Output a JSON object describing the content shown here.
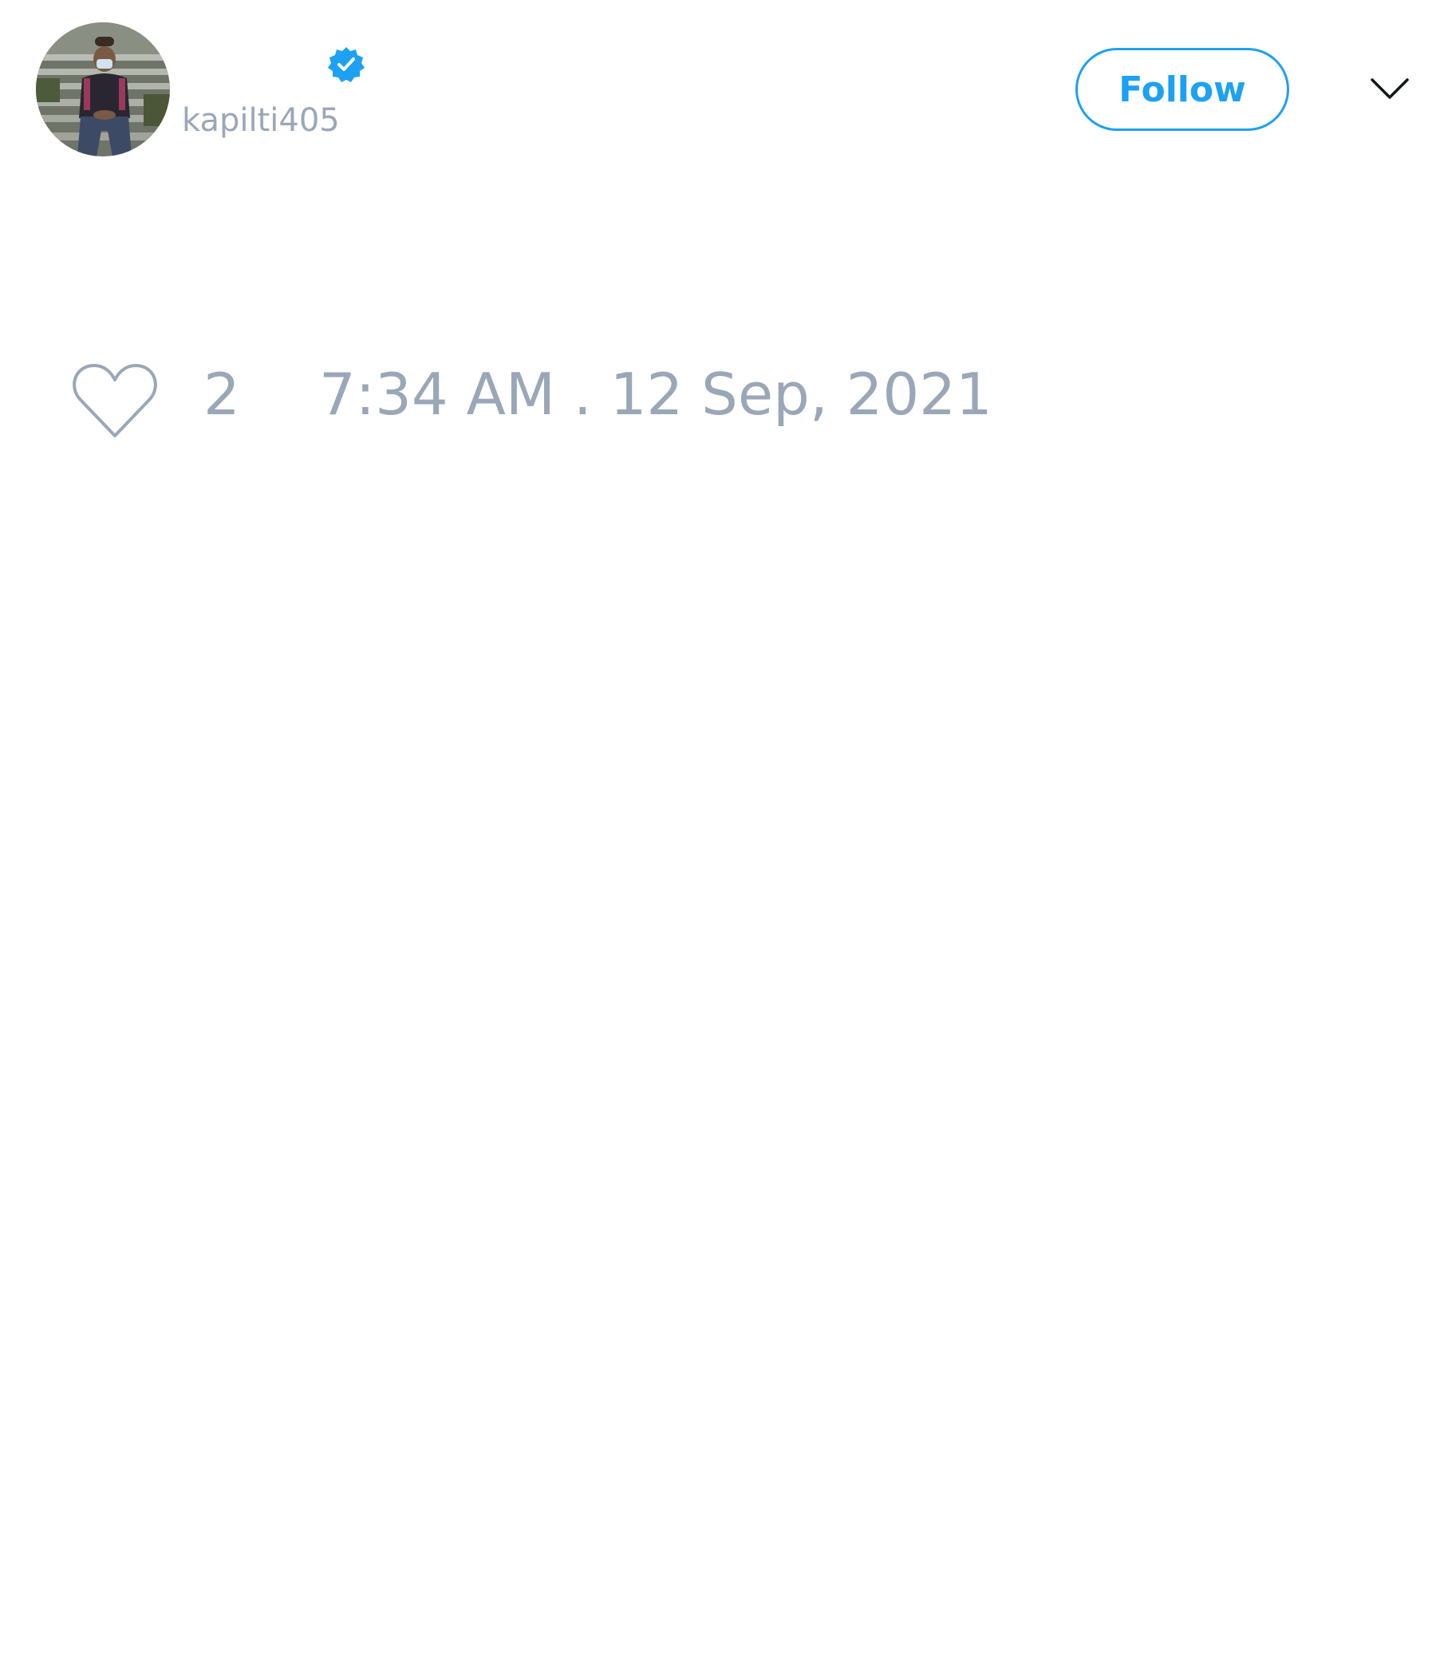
{
  "tweet": {
    "author": {
      "display_name": "",
      "handle": "kapilti405",
      "verified": true,
      "avatar_icon": "user-photo-avatar"
    },
    "follow_label": "Follow",
    "menu_icon": "chevron-down-icon",
    "likes": {
      "icon": "heart-outline-icon",
      "count": "2"
    },
    "timestamp": "7:34 AM . 12 Sep, 2021"
  },
  "colors": {
    "accent": "#1da1f2",
    "muted_text": "#9aa7b8",
    "background": "#ffffff"
  }
}
